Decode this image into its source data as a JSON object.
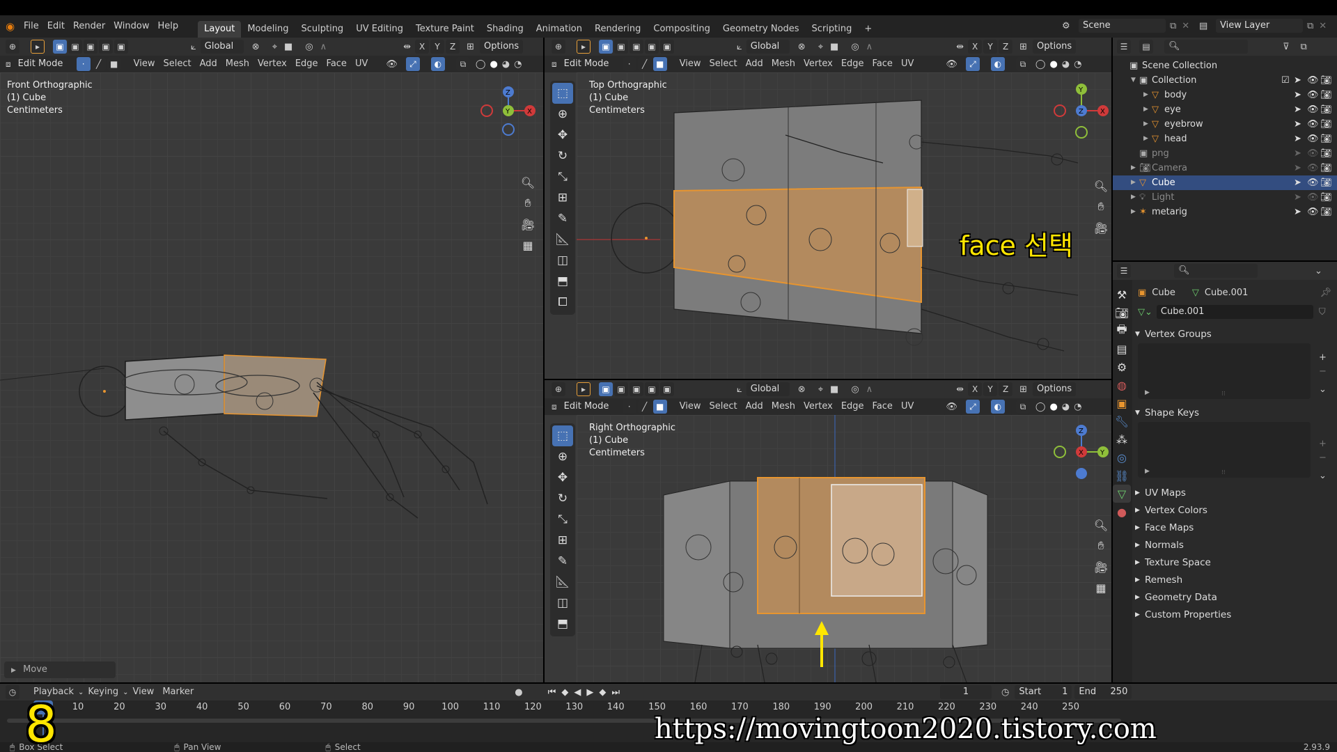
{
  "topbar": {
    "menus": [
      "File",
      "Edit",
      "Render",
      "Window",
      "Help"
    ],
    "workspaces": [
      "Layout",
      "Modeling",
      "Sculpting",
      "UV Editing",
      "Texture Paint",
      "Shading",
      "Animation",
      "Rendering",
      "Compositing",
      "Geometry Nodes",
      "Scripting"
    ],
    "active_workspace": "Layout",
    "scene": "Scene",
    "view_layer": "View Layer"
  },
  "viewport_header": {
    "orientation": "Global",
    "options": "Options",
    "axes": [
      "X",
      "Y",
      "Z"
    ],
    "mode": "Edit Mode",
    "menus": [
      "View",
      "Select",
      "Add",
      "Mesh",
      "Vertex",
      "Edge",
      "Face",
      "UV"
    ]
  },
  "viewports": {
    "left": {
      "view": "Front Orthographic",
      "object": "(1) Cube",
      "units": "Centimeters",
      "last_op": "Move"
    },
    "top_right": {
      "view": "Top Orthographic",
      "object": "(1) Cube",
      "units": "Centimeters",
      "annotation": "face 선택"
    },
    "bottom_right": {
      "view": "Right Orthographic",
      "object": "(1) Cube",
      "units": "Centimeters"
    }
  },
  "outliner": {
    "root": "Scene Collection",
    "collection": "Collection",
    "items": [
      {
        "name": "body",
        "indent": 2,
        "kind": "mesh"
      },
      {
        "name": "eye",
        "indent": 2,
        "kind": "mesh"
      },
      {
        "name": "eyebrow",
        "indent": 2,
        "kind": "mesh"
      },
      {
        "name": "head",
        "indent": 2,
        "kind": "mesh"
      },
      {
        "name": "png",
        "indent": 1,
        "kind": "collection"
      },
      {
        "name": "Camera",
        "indent": 1,
        "kind": "camera"
      },
      {
        "name": "Cube",
        "indent": 1,
        "kind": "mesh",
        "selected": true
      },
      {
        "name": "Light",
        "indent": 1,
        "kind": "light"
      },
      {
        "name": "metarig",
        "indent": 1,
        "kind": "armature"
      }
    ]
  },
  "properties": {
    "object": "Cube",
    "mesh": "Cube.001",
    "datablock": "Cube.001",
    "panels_open": [
      "Vertex Groups",
      "Shape Keys"
    ],
    "panels_closed": [
      "UV Maps",
      "Vertex Colors",
      "Face Maps",
      "Normals",
      "Texture Space",
      "Remesh",
      "Geometry Data",
      "Custom Properties"
    ]
  },
  "timeline": {
    "menus": [
      "Playback",
      "Keying",
      "View",
      "Marker"
    ],
    "current_frame": "1",
    "start_label": "Start",
    "start": "1",
    "end_label": "End",
    "end": "250",
    "ticks": [
      "10",
      "20",
      "30",
      "40",
      "50",
      "60",
      "70",
      "80",
      "90",
      "100",
      "110",
      "120",
      "130",
      "140",
      "150",
      "160",
      "170",
      "180",
      "190",
      "200",
      "210",
      "220",
      "230",
      "240",
      "250"
    ]
  },
  "statusbar": {
    "items": [
      "Box Select",
      "Pan View",
      "Select"
    ],
    "version": "2.93.9"
  },
  "overlay": {
    "step_number": "8",
    "url": "https://movingtoon2020.tistory.com"
  },
  "colors": {
    "accent": "#4772b3",
    "selection": "#e8952f",
    "annotation": "#ffe600"
  }
}
